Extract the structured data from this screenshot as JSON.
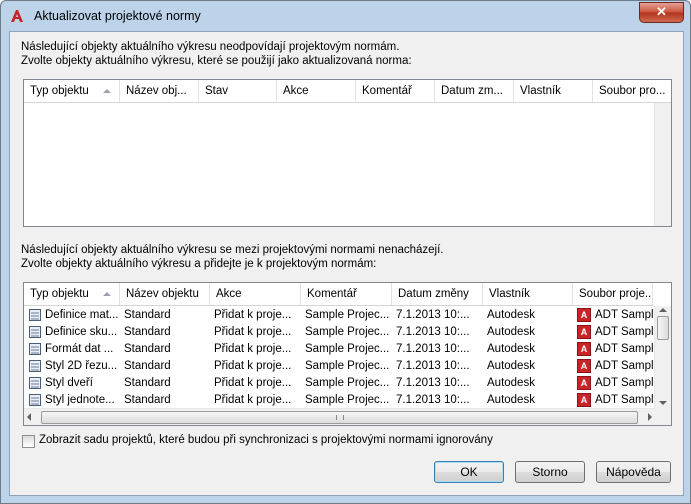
{
  "window": {
    "title": "Aktualizovat projektové normy",
    "close_label": "✕"
  },
  "section1": {
    "line1": "Následující objekty aktuálního výkresu neodpovídají projektovým normám.",
    "line2": "Zvolte objekty aktuálního výkresu, které se použijí jako aktualizovaná norma:",
    "columns": [
      "Typ objektu",
      "Název obj...",
      "Stav",
      "Akce",
      "Komentář",
      "Datum zm...",
      "Vlastník",
      "Soubor pro..."
    ]
  },
  "section2": {
    "line1": "Následující objekty aktuálního výkresu se mezi projektovými normami nenacházejí.",
    "line2": "Zvolte objekty aktuálního výkresu a přidejte je k projektovým normám:",
    "columns": [
      "Typ objektu",
      "Název objektu",
      "Akce",
      "Komentář",
      "Datum změny",
      "Vlastník",
      "Soubor proje..."
    ],
    "rows": [
      {
        "icon": "material-definition-icon",
        "type": "Definice mat...",
        "name": "Standard",
        "action": "Přidat k proje...",
        "comment": "Sample Projec...",
        "date": "7.1.2013 10:...",
        "owner": "Autodesk",
        "file": "ADT Sample"
      },
      {
        "icon": "component-definition-icon",
        "type": "Definice sku...",
        "name": "Standard",
        "action": "Přidat k proje...",
        "comment": "Sample Projec...",
        "date": "7.1.2013 10:...",
        "owner": "Autodesk",
        "file": "ADT Sample"
      },
      {
        "icon": "data-format-icon",
        "type": "Formát dat ...",
        "name": "Standard",
        "action": "Přidat k proje...",
        "comment": "Sample Projec...",
        "date": "7.1.2013 10:...",
        "owner": "Autodesk",
        "file": "ADT Sample"
      },
      {
        "icon": "section-style-icon",
        "type": "Styl 2D řezu...",
        "name": "Standard",
        "action": "Přidat k proje...",
        "comment": "Sample Projec...",
        "date": "7.1.2013 10:...",
        "owner": "Autodesk",
        "file": "ADT Sample"
      },
      {
        "icon": "door-style-icon",
        "type": "Styl dveří",
        "name": "Standard",
        "action": "Přidat k proje...",
        "comment": "Sample Projec...",
        "date": "7.1.2013 10:...",
        "owner": "Autodesk",
        "file": "ADT Sample"
      },
      {
        "icon": "unit-style-icon",
        "type": "Styl jednote...",
        "name": "Standard",
        "action": "Přidat k proje...",
        "comment": "Sample Projec...",
        "date": "7.1.2013 10:...",
        "owner": "Autodesk",
        "file": "ADT Sample"
      }
    ]
  },
  "checkbox": {
    "label": "Zobrazit sadu projektů, které budou při synchronizaci s projektovými normami ignorovány",
    "checked": false
  },
  "buttons": {
    "ok": "OK",
    "cancel": "Storno",
    "help": "Nápověda"
  },
  "colors": {
    "accent": "#c8242a",
    "frame": "#bcd3ea"
  }
}
